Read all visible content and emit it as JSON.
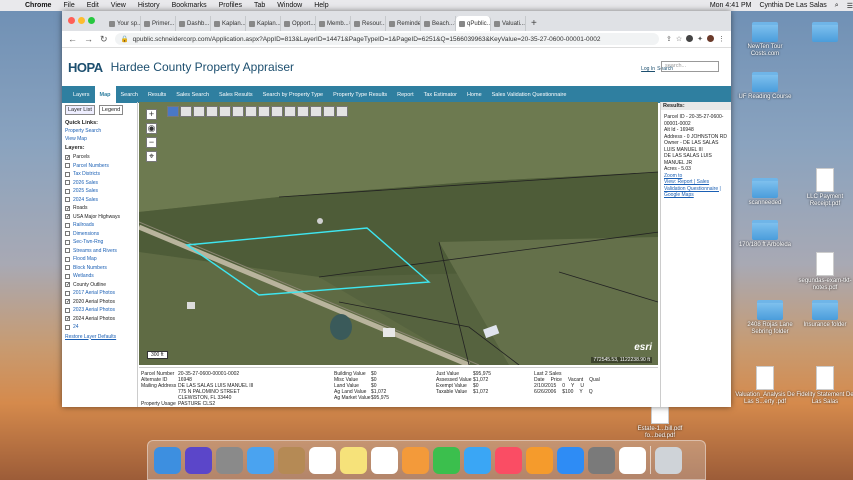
{
  "macbar": {
    "menus": [
      "Chrome",
      "File",
      "Edit",
      "View",
      "History",
      "Bookmarks",
      "Profiles",
      "Tab",
      "Window",
      "Help"
    ],
    "clock": "Mon 4:41 PM",
    "user": "Cynthia De Las Salas"
  },
  "desktop": [
    {
      "label": "NewTen Tour Costs.com",
      "type": "folder"
    },
    {
      "label": "",
      "type": "folder"
    },
    {
      "label": "UF Reading Course",
      "type": "folder"
    },
    {
      "label": "LLC Payment Receipt.pdf",
      "type": "doc"
    },
    {
      "label": "scanneeded",
      "type": "folder"
    },
    {
      "label": "170/180 ft Arboleda",
      "type": "folder"
    },
    {
      "label": "segundas-exam-tkt-notes.pdf",
      "type": "doc"
    },
    {
      "label": "2408 Rojas Lane Sebring folder",
      "type": "folder"
    },
    {
      "label": "Insurance folder",
      "type": "folder"
    },
    {
      "label": "Valuation_Analysis De Las S...erty .pdf",
      "type": "doc"
    },
    {
      "label": "Fidelity Statement De Las Salas",
      "type": "doc"
    },
    {
      "label": "Estate-1...bill.pdf fo...bed.pdf",
      "type": "doc"
    }
  ],
  "browser": {
    "tabs": [
      "Your sp...",
      "Primer...",
      "Dashb...",
      "Kaplan...",
      "Kaplan...",
      "Opport...",
      "Memb...",
      "Resour...",
      "Reminde...",
      "Beach...",
      "qPublic...",
      "Valuati..."
    ],
    "url": "qpublic.schneidercorp.com/Application.aspx?AppID=813&LayerID=14471&PageTypeID=1&PageID=6251&Q=1566039963&KeyValue=20-35-27-0600-00001-0002"
  },
  "site": {
    "logo": "HOPA",
    "title": "Hardee County Property Appraiser",
    "login": "Log In",
    "search_label": "Search",
    "search_placeholder": "search...",
    "menu": [
      "Layers",
      "Map",
      "Search",
      "Results",
      "Sales Search",
      "Sales Results",
      "Search by Property Type",
      "Property Type Results",
      "Report",
      "Tax Estimator",
      "Home",
      "Sales Validation Questionnaire"
    ]
  },
  "left": {
    "tabs": [
      "Layer List",
      "Legend"
    ],
    "quick_links_title": "Quick Links:",
    "quick_links": [
      "Property Search",
      "View Map"
    ],
    "layers_title": "Layers:",
    "layers": [
      {
        "label": "Parcels",
        "checked": true
      },
      {
        "label": "Parcel Numbers",
        "checked": false
      },
      {
        "label": "Tax Districts",
        "checked": false
      },
      {
        "label": "2026 Sales",
        "checked": false
      },
      {
        "label": "2025 Sales",
        "checked": false
      },
      {
        "label": "2024 Sales",
        "checked": false
      },
      {
        "label": "Roads",
        "checked": true
      },
      {
        "label": "USA Major Highways",
        "checked": true
      },
      {
        "label": "Railroads",
        "checked": false
      },
      {
        "label": "Dimensions",
        "checked": false
      },
      {
        "label": "Sec-Twn-Rng",
        "checked": false
      },
      {
        "label": "Streams and Rivers",
        "checked": false
      },
      {
        "label": "Flood Map",
        "checked": false
      },
      {
        "label": "Block Numbers",
        "checked": false
      },
      {
        "label": "Wetlands",
        "checked": false
      },
      {
        "label": "County Outline",
        "checked": true
      },
      {
        "label": "2017 Aerial Photos",
        "checked": false
      },
      {
        "label": "2020 Aerial Photos",
        "checked": true
      },
      {
        "label": "2023 Aerial Photos",
        "checked": false
      },
      {
        "label": "2024 Aerial Photos",
        "checked": true
      },
      {
        "label": "24",
        "checked": false
      }
    ],
    "restore": "Restore Layer Defaults"
  },
  "map": {
    "scale": "300 ft",
    "coords": "772545.53, 1122238.90 ft",
    "attribution": "esri"
  },
  "results": {
    "title": "Results:",
    "lines": [
      "Parcel ID - 20-35-27-0600-00001-0002",
      "Alt Id - 16948",
      "Address - 0 JOHNSTON RD",
      "Owner - DE LAS SALAS LUIS MANUEL III",
      "DE LAS SALAS LUIS MANUEL JR",
      "Acres - 5.03"
    ],
    "links": [
      "Zoom to",
      "View: Report | Sales Validation Questionnaire | Google Maps"
    ]
  },
  "bottom": {
    "col1": [
      [
        "Parcel Number",
        "20-35-27-0600-00001-0002"
      ],
      [
        "Alternate ID",
        "16948"
      ],
      [
        "Mailing Address",
        "DE LAS SALAS LUIS MANUEL III"
      ],
      [
        "",
        "775 N PALOMINO STREET"
      ],
      [
        "",
        "CLEWISTON, FL 33440"
      ],
      [
        "Property Usage",
        "PASTURE CLS2"
      ]
    ],
    "col2": [
      [
        "Building Value",
        "$0"
      ],
      [
        "Misc Value",
        "$0"
      ],
      [
        "Land Value",
        "$0"
      ],
      [
        "Ag Land Value",
        "$1,072"
      ],
      [
        "Ag Market Value",
        "$95,975"
      ]
    ],
    "col3": [
      [
        "Just Value",
        "$95,975"
      ],
      [
        "Assessed Value",
        "$1,072"
      ],
      [
        "Exempt Value",
        "$0"
      ],
      [
        "Taxable Value",
        "$1,072"
      ]
    ],
    "sales_title": "Last 2 Sales",
    "sales_header": [
      "Date",
      "Price",
      "Vacant",
      "Qual"
    ],
    "sales": [
      [
        "2/10/2015",
        "0",
        "Y",
        "U"
      ],
      [
        "6/26/2006",
        "$100",
        "Y",
        "Q"
      ]
    ]
  },
  "dock_icons": [
    "finder-icon",
    "siri-icon",
    "launchpad-icon",
    "mail-icon",
    "contacts-icon",
    "calendar-icon",
    "notes-icon",
    "reminders-icon",
    "photos-icon",
    "facetime-icon",
    "messages-icon",
    "music-icon",
    "books-icon",
    "appstore-icon",
    "preferences-icon",
    "chrome-icon",
    "trash-icon"
  ]
}
